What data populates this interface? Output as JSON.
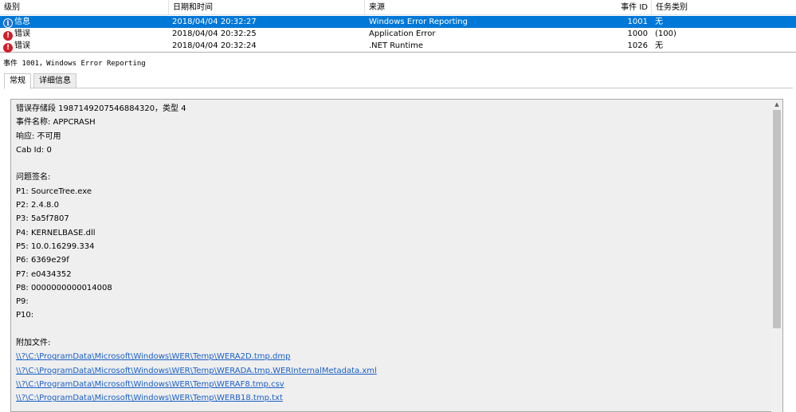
{
  "columns": {
    "level": "级别",
    "datetime": "日期和时间",
    "source": "来源",
    "event_id": "事件 ID",
    "task_category": "任务类别"
  },
  "events": [
    {
      "level": "信息",
      "icon": "info-icon",
      "datetime": "2018/04/04 20:32:27",
      "source": "Windows Error Reporting",
      "event_id": "1001",
      "task_category": "无",
      "selected": true
    },
    {
      "level": "错误",
      "icon": "error-icon",
      "datetime": "2018/04/04 20:32:25",
      "source": "Application Error",
      "event_id": "1000",
      "task_category": "(100)",
      "selected": false
    },
    {
      "level": "错误",
      "icon": "error-icon",
      "datetime": "2018/04/04 20:32:24",
      "source": ".NET Runtime",
      "event_id": "1026",
      "task_category": "无",
      "selected": false
    }
  ],
  "detail": {
    "title": "事件 1001，Windows Error Reporting",
    "tabs": [
      "常规",
      "详细信息"
    ],
    "active_tab": "常规",
    "lines": [
      "错误存储段 1987149207546884320，类型 4",
      "事件名称: APPCRASH",
      "响应: 不可用",
      "Cab Id: 0",
      "",
      "问题签名:",
      "P1: SourceTree.exe",
      "P2: 2.4.8.0",
      "P3: 5a5f7807",
      "P4: KERNELBASE.dll",
      "P5: 10.0.16299.334",
      "P6: 6369e29f",
      "P7: e0434352",
      "P8: 0000000000014008",
      "P9:",
      "P10:",
      "",
      "附加文件:"
    ],
    "links": [
      "\\\\?\\C:\\ProgramData\\Microsoft\\Windows\\WER\\Temp\\WERA2D.tmp.dmp",
      "\\\\?\\C:\\ProgramData\\Microsoft\\Windows\\WER\\Temp\\WERADA.tmp.WERInternalMetadata.xml",
      "\\\\?\\C:\\ProgramData\\Microsoft\\Windows\\WER\\Temp\\WERAF8.tmp.csv",
      "\\\\?\\C:\\ProgramData\\Microsoft\\Windows\\WER\\Temp\\WERB18.tmp.txt"
    ]
  },
  "colors": {
    "selection": "#0078d7",
    "link": "#1a5fc8",
    "info_icon": "#1f6fd1",
    "error_icon": "#d0202a"
  }
}
